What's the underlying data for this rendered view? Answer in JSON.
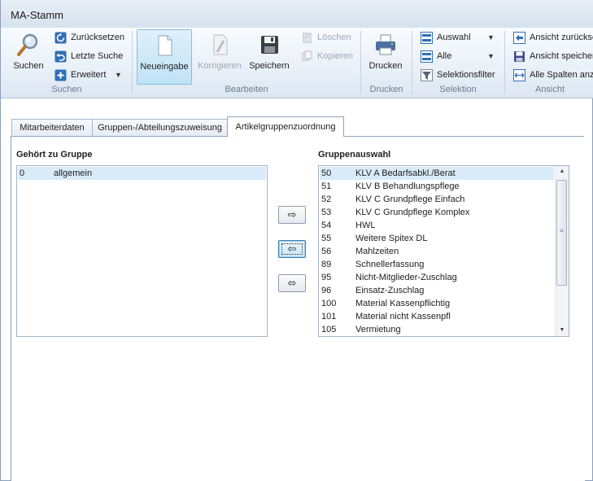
{
  "window": {
    "title": "MA-Stamm"
  },
  "ribbon": {
    "suchen": {
      "label": "Suchen",
      "search_button": "Suchen",
      "reset": "Zurücksetzen",
      "last_search": "Letzte Suche",
      "extended": "Erweitert"
    },
    "bearbeiten": {
      "label": "Bearbeiten",
      "new_entry": "Neueingabe",
      "correct": "Korrigieren",
      "save": "Speichern",
      "delete": "Löschen",
      "copy": "Kopieren"
    },
    "drucken": {
      "label": "Drucken",
      "print": "Drucken"
    },
    "selektion": {
      "label": "Selektion",
      "selection": "Auswahl",
      "all": "Alle",
      "filter": "Selektionsfilter"
    },
    "ansicht": {
      "label": "Ansicht",
      "reset_view": "Ansicht zurückse",
      "save_view": "Ansicht speicher",
      "all_columns": "Alle Spalten anze"
    }
  },
  "tabs": [
    {
      "label": "Mitarbeiterdaten"
    },
    {
      "label": "Gruppen-/Abteilungszuweisung"
    },
    {
      "label": "Artikelgruppenzuordnung"
    }
  ],
  "left_panel": {
    "label": "Gehört zu Gruppe",
    "rows": [
      {
        "code": "0",
        "name": "allgemein"
      }
    ]
  },
  "right_panel": {
    "label": "Gruppenauswahl",
    "rows": [
      {
        "code": "50",
        "name": "KLV A Bedarfsabkl./Berat"
      },
      {
        "code": "51",
        "name": "KLV B Behandlungspflege"
      },
      {
        "code": "52",
        "name": "KLV C Grundpflege Einfach"
      },
      {
        "code": "53",
        "name": "KLV C Grundpflege Komplex"
      },
      {
        "code": "54",
        "name": "HWL"
      },
      {
        "code": "55",
        "name": "Weitere Spitex DL"
      },
      {
        "code": "56",
        "name": "Mahlzeiten"
      },
      {
        "code": "89",
        "name": "Schnellerfassung"
      },
      {
        "code": "95",
        "name": "Nicht-Mitglieder-Zuschlag"
      },
      {
        "code": "96",
        "name": "Einsatz-Zuschlag"
      },
      {
        "code": "100",
        "name": "Material Kassenpflichtig"
      },
      {
        "code": "101",
        "name": "Material nicht Kassenpfl"
      },
      {
        "code": "105",
        "name": "Vermietung"
      }
    ]
  },
  "transfer_buttons": {
    "add": "⇨",
    "remove": "⇦",
    "swap": "⬄"
  },
  "colors": {
    "selection": "#d9ebf8",
    "accent": "#3c7fb1"
  }
}
